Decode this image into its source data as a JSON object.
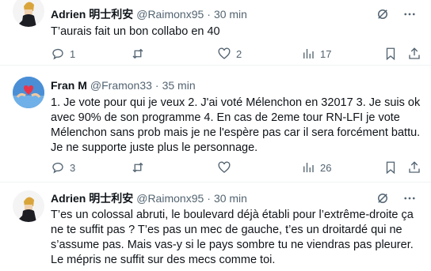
{
  "tweets": [
    {
      "author": "Adrien 明士利安",
      "handle": "@Raimonx95",
      "separator": "·",
      "time": "30 min",
      "text": "T’aurais fait un bon collabo en 40",
      "actions": {
        "replies": "1",
        "retweets": "",
        "likes": "2",
        "views": "17"
      }
    },
    {
      "author": "Fran M",
      "handle": "@Framon33",
      "separator": "·",
      "time": "35 min",
      "text": "1. Je vote pour qui je veux 2. J'ai voté Mélenchon en 32017 3. Je suis ok avec 90% de son programme 4. En cas de 2eme tour RN-LFI je vote Mélenchon sans prob mais je ne l'espère pas car il sera forcément battu. Je ne supporte juste plus le personnage.",
      "actions": {
        "replies": "3",
        "retweets": "",
        "likes": "",
        "views": "26"
      }
    },
    {
      "author": "Adrien 明士利安",
      "handle": "@Raimonx95",
      "separator": "·",
      "time": "30 min",
      "text_lines": [
        "T’es un colossal abruti, le boulevard déjà établi pour l’extrême-droite ça ne te suffit pas ? T’es pas un mec de gauche, t’es un droitardé qui ne s’assume pas. Mais vas-y si le pays sombre tu ne viendras pas pleurer.",
        "Le mépris ne suffit sur des mecs comme toi."
      ]
    }
  ],
  "icons": {
    "grok": "grok-icon",
    "more": "more-icon",
    "reply": "reply-icon",
    "retweet": "retweet-icon",
    "like": "like-icon",
    "views": "views-icon",
    "bookmark": "bookmark-icon",
    "share": "share-icon"
  },
  "colors": {
    "text": "#0f1419",
    "secondary": "#536471",
    "divider": "#eff3f4",
    "avatar2_bg": "#4a8fd6"
  }
}
